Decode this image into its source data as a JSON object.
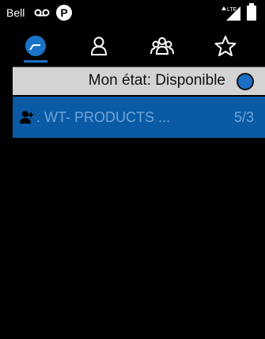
{
  "status_bar": {
    "carrier": "Bell",
    "icons": [
      "voicemail-icon",
      "parking-icon",
      "lte-signal-icon",
      "battery-icon"
    ],
    "network_label": "LTE"
  },
  "tabs": [
    {
      "name": "recent",
      "icon": "recent-calls-icon",
      "selected": true
    },
    {
      "name": "contacts",
      "icon": "contact-icon",
      "selected": false
    },
    {
      "name": "groups",
      "icon": "group-icon",
      "selected": false
    },
    {
      "name": "favorites",
      "icon": "star-icon",
      "selected": false
    }
  ],
  "availability": {
    "label": "Mon état: Disponible",
    "indicator_color": "#1b6fc4"
  },
  "group_item": {
    "icon": "group-user-icon",
    "name": ". WT- PRODUCTS ...",
    "count": "5/3"
  },
  "colors": {
    "accent": "#1a73c6",
    "row_selected": "#0a5aa6",
    "status_bg": "#d3d3d3"
  }
}
